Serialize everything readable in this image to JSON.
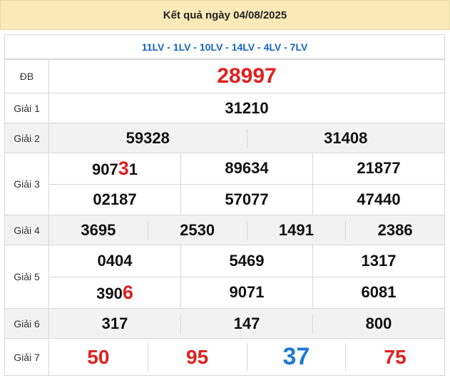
{
  "header": {
    "title": "Kết quả ngày 04/08/2025"
  },
  "codes": "11LV - 1LV - 10LV - 14LV - 4LV - 7LV",
  "prizes": {
    "db": {
      "label": "ĐB",
      "value": "28997"
    },
    "g1": {
      "label": "Giải 1",
      "values": [
        "31210"
      ]
    },
    "g2": {
      "label": "Giải 2",
      "values": [
        "59328",
        "31408"
      ]
    },
    "g3": {
      "label": "Giải 3",
      "row1": [
        "907",
        "3",
        "1",
        "89634",
        "21877"
      ],
      "row2": [
        "02187",
        "57077",
        "47440"
      ]
    },
    "g4": {
      "label": "Giải 4",
      "values": [
        "3695",
        "2530",
        "1491",
        "2386"
      ]
    },
    "g5": {
      "label": "Giải 5",
      "row1": [
        "0404",
        "5469",
        "1317"
      ],
      "row2": [
        "390",
        "6",
        "9071",
        "6081"
      ]
    },
    "g6": {
      "label": "Giải 6",
      "values": [
        "317",
        "147",
        "800"
      ]
    },
    "g7": {
      "label": "Giải 7",
      "values": [
        "50",
        "95",
        "37",
        "75"
      ]
    }
  },
  "colors": {
    "red": "#e02020",
    "blue": "#1f7ad1",
    "code_blue": "#1565c0",
    "header_bg": "#fce9b8"
  }
}
